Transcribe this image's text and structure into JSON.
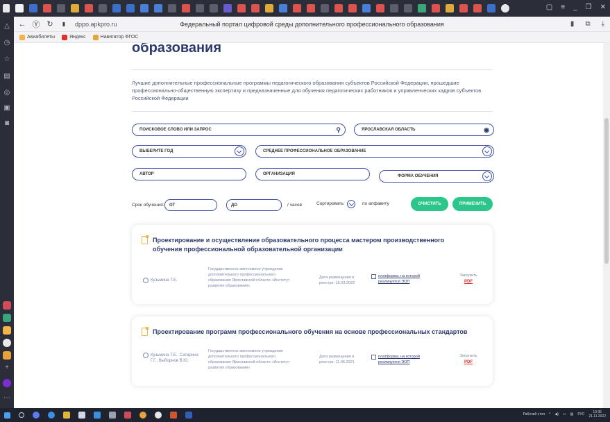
{
  "browser": {
    "url": "dppo.apkpro.ru",
    "page_title": "Федеральный портал цифровой среды дополнительного профессионального образования",
    "bookmarks": [
      "Авиабилеты",
      "Яндекс",
      "Навигатор ФГОС"
    ]
  },
  "page": {
    "heading": "образования",
    "description": "Лучшие дополнительные профессиональные программы педагогического образования субъектов Российской Федерации, прошедшие профессионально-общественную экспертизу и предназначенные для обучения педагогических работников и управленческих кадров субъектов Российской Федерации"
  },
  "filters": {
    "search_placeholder": "Поисковое слово или запрос",
    "region": "Ярославская область",
    "year": "Выберите год",
    "education_level": "Среднее профессиональное образование",
    "author": "Автор",
    "organization": "Организация",
    "study_form": "Форма обучения",
    "duration_label": "Срок обучения:",
    "from_placeholder": "от",
    "to_placeholder": "до",
    "hours_unit": "/ часов",
    "sort_label": "Сортировать:",
    "sort_value": "по алфавиту",
    "clear_button": "Очистить",
    "apply_button": "Применить"
  },
  "programs": [
    {
      "title": "Проектирование и осуществление образовательного процесса мастером производственного обучения профессиональной образовательной организации",
      "authors": "Кузьмина Т.Е.",
      "organization": "Государственное автономное учреждение дополнительного профессионального образования Ярославской области «Институт развития образования»",
      "date": "Дата размещения в реестре: 16.03.2022",
      "platform": "платформа, на которой реализуется ЭОП",
      "download_label": "Загрузить",
      "file_type": "PDF"
    },
    {
      "title": "Проектирование программ профессионального обучения на основе профессиональных стандартов",
      "authors": "Кузьмина Т.Е., Сатарина Г.Г., Выборнов В.Ю.",
      "organization": "Государственное автономное учреждение дополнительного профессионального образования Ярославской области «Институт развития образования»",
      "date": "Дата размещения в реестре: 11.06.2021",
      "platform": "платформа, на которой реализуется ЭОП",
      "download_label": "Загрузить",
      "file_type": "PDF"
    }
  ],
  "taskbar": {
    "desktop_label": "Рабочий стол",
    "language": "РУС",
    "time": "13:35",
    "date": "21.11.2022"
  },
  "colors": {
    "accent": "#3e4fa8",
    "title": "#2d3a6e",
    "button": "#2bc78a",
    "pdf": "#e0302e",
    "doc_icon": "#f0b44a"
  }
}
